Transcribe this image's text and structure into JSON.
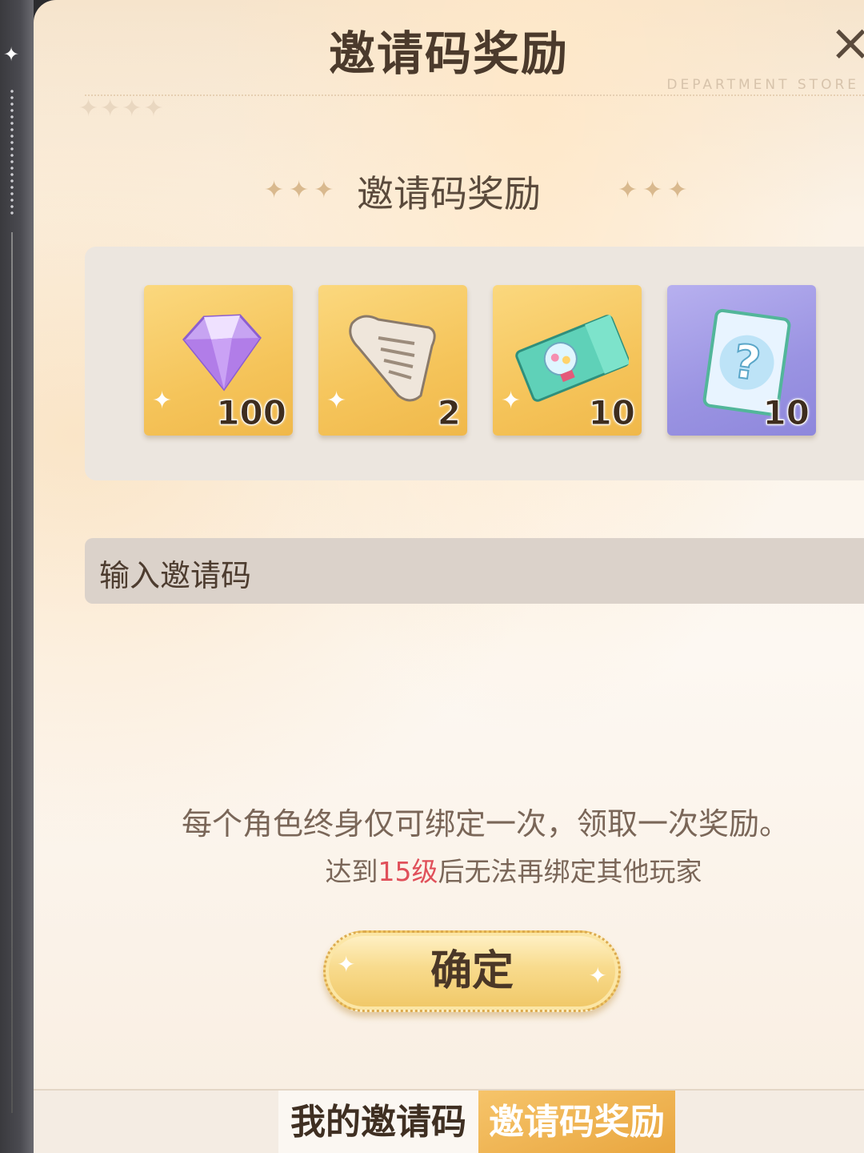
{
  "header": {
    "title": "邀请码奖励",
    "close_label": "×",
    "subtitle_en": "DEPARTMENT STORE",
    "title_stars": "✦✦✦✦"
  },
  "rewards_section": {
    "title": "邀请码奖励",
    "deco_left": "✦✦✦",
    "deco_right": "✦✦✦",
    "items": [
      {
        "icon": "purple-diamond-icon",
        "qty": "100"
      },
      {
        "icon": "scroll-icon",
        "qty": "2"
      },
      {
        "icon": "gacha-ticket-icon",
        "qty": "10"
      },
      {
        "icon": "mystery-card-icon",
        "qty": "10"
      }
    ]
  },
  "invite_input": {
    "placeholder": "输入邀请码"
  },
  "notes": {
    "main": "每个角色终身仅可绑定一次，领取一次奖励。",
    "sub_prefix": "达到",
    "sub_highlight": "15级",
    "sub_suffix": "后无法再绑定其他玩家"
  },
  "confirm_button": {
    "label": "确定"
  },
  "tabs": [
    {
      "label": "我的邀请码",
      "active": false
    },
    {
      "label": "邀请码奖励",
      "active": true
    }
  ],
  "colors": {
    "accent_gold": "#f0c766",
    "highlight_red": "#e0505a",
    "text_brown": "#4b3a2c"
  }
}
